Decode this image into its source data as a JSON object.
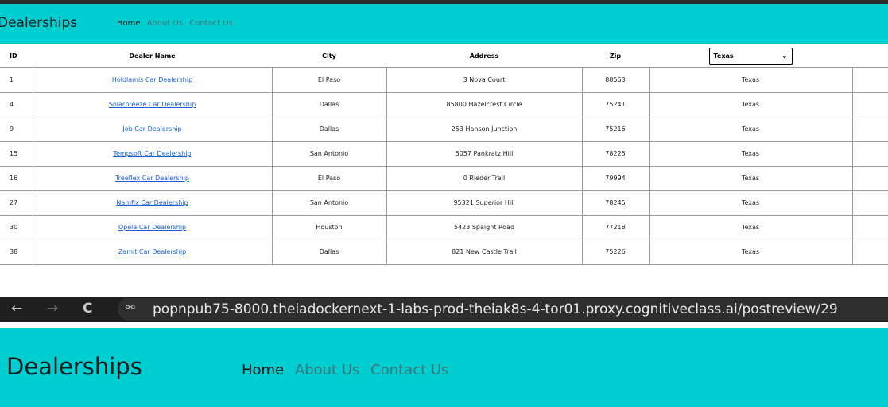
{
  "top_app": {
    "brand": "Dealerships",
    "nav": {
      "home": "Home",
      "about": "About Us",
      "contact": "Contact Us"
    },
    "table": {
      "headers": {
        "id": "ID",
        "name": "Dealer Name",
        "city": "City",
        "address": "Address",
        "zip": "Zip"
      },
      "state_filter": "Texas",
      "rows": [
        {
          "id": "1",
          "name": "Holdlamis Car Dealership",
          "city": "El Paso",
          "address": "3 Nova Court",
          "zip": "88563",
          "state": "Texas"
        },
        {
          "id": "4",
          "name": "Solarbreeze Car Dealership",
          "city": "Dallas",
          "address": "85800 Hazelcrest Circle",
          "zip": "75241",
          "state": "Texas"
        },
        {
          "id": "9",
          "name": "Job Car Dealership",
          "city": "Dallas",
          "address": "253 Hanson Junction",
          "zip": "75216",
          "state": "Texas"
        },
        {
          "id": "15",
          "name": "Tempsoft Car Dealership",
          "city": "San Antonio",
          "address": "5057 Pankratz Hill",
          "zip": "78225",
          "state": "Texas"
        },
        {
          "id": "16",
          "name": "Treeflex Car Dealership",
          "city": "El Paso",
          "address": "0 Rieder Trail",
          "zip": "79994",
          "state": "Texas"
        },
        {
          "id": "27",
          "name": "Namfix Car Dealership",
          "city": "San Antonio",
          "address": "95321 Superior Hill",
          "zip": "78245",
          "state": "Texas"
        },
        {
          "id": "30",
          "name": "Opela Car Dealership",
          "city": "Houston",
          "address": "5423 Spaight Road",
          "zip": "77218",
          "state": "Texas"
        },
        {
          "id": "38",
          "name": "Zamit Car Dealership",
          "city": "Dallas",
          "address": "821 New Castle Trail",
          "zip": "75226",
          "state": "Texas"
        }
      ]
    }
  },
  "browser": {
    "back_icon": "←",
    "forward_icon": "→",
    "reload_icon": "C",
    "site_info_icon": "⚯",
    "url": "popnpub75-8000.theiadockernext-1-labs-prod-theiak8s-4-tor01.proxy.cognitiveclass.ai/postreview/29"
  },
  "bottom_app": {
    "brand": "Dealerships",
    "nav": {
      "home": "Home",
      "about": "About Us",
      "contact": "Contact Us"
    }
  },
  "colors": {
    "navbar": "#00ced1",
    "link": "#1a5fd6",
    "browser_bg": "#1f1f1f"
  }
}
